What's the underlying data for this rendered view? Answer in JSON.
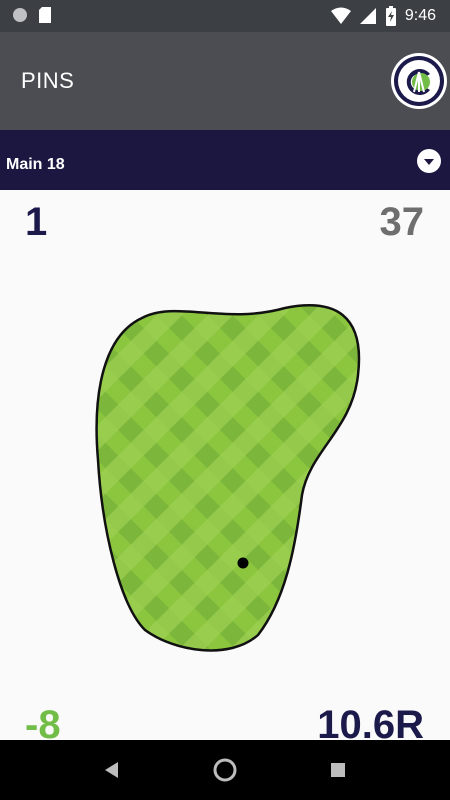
{
  "status_bar": {
    "time": "9:46",
    "icons": [
      "circle-status-icon",
      "sd-card-icon",
      "wifi-icon",
      "cell-signal-icon",
      "battery-icon"
    ]
  },
  "app_bar": {
    "title": "PINS",
    "logo_icon": "club-logo-icon"
  },
  "selector": {
    "course_name": "Main 18",
    "dropdown_icon": "chevron-down-icon"
  },
  "hole": {
    "number": "1",
    "yardage": "37",
    "pin_depth": "-8",
    "pin_side": "10.6R"
  },
  "colors": {
    "accent_navy": "#1b1740",
    "green_fill": "#8cc63f",
    "depth_green": "#72bd48",
    "yardage_gray": "#6e6e6e"
  },
  "nav_bar": {
    "icons": [
      "back-icon",
      "home-icon",
      "recents-icon"
    ]
  }
}
